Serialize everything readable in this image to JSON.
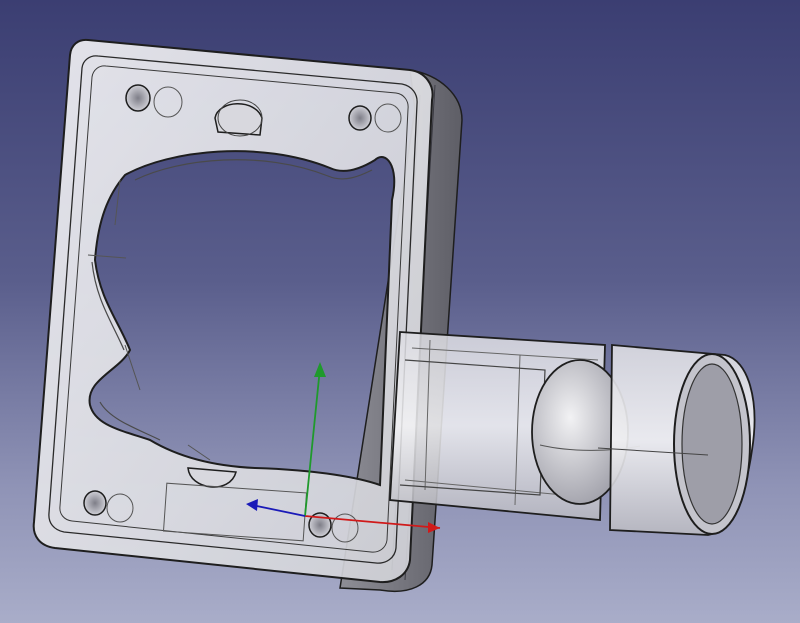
{
  "viewport": {
    "background_top": "#3b3e72",
    "background_bottom": "#a9adc9"
  },
  "model": {
    "face_color": "#e6e6ea",
    "edge_color": "#1e1e1e",
    "transparency": "semi-transparent"
  },
  "axes": {
    "x_color": "#d01a1a",
    "y_color": "#1f9a2c",
    "z_color": "#1a1ab8"
  },
  "icons": [
    "axis-cross-icon"
  ]
}
